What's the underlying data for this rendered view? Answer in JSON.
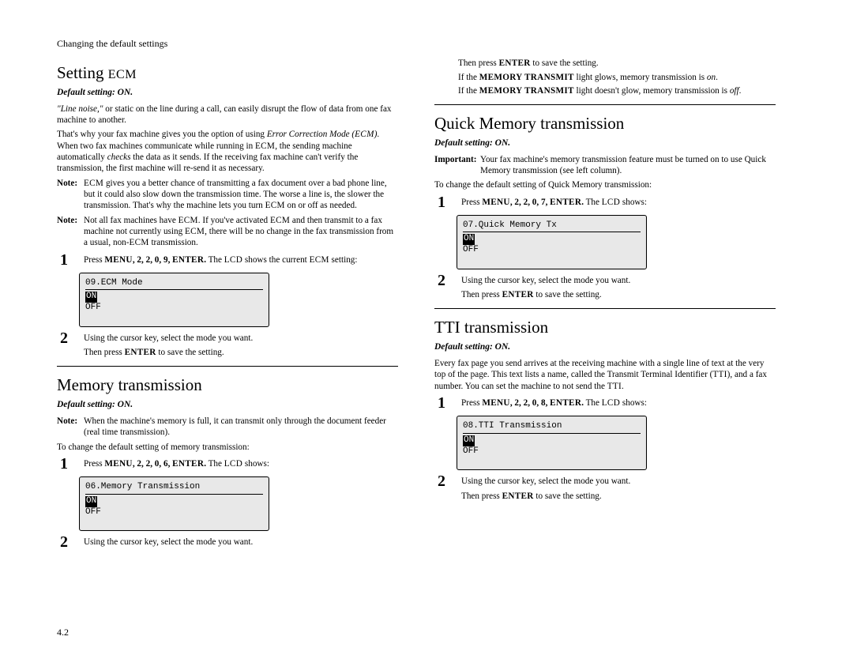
{
  "running_head": "Changing the default settings",
  "page_number": "4.2",
  "left": {
    "s1": {
      "title_a": "Setting ",
      "title_b": "ECM",
      "default": "Default setting: ON.",
      "p1a": "\"Line noise,\"",
      "p1b": " or static on the line during a call, can easily disrupt the flow of data from one fax machine to another.",
      "p2a": "That's why your fax machine gives you the option of using ",
      "p2b": "Error Correction Mode (",
      "p2c": "ECM",
      "p2d": ")",
      "p2e": ". When two fax machines communicate while running in ",
      "p2f": "ECM",
      "p2g": ", the sending machine automatically ",
      "p2h": "checks",
      "p2i": " the data as it sends. If the receiving fax machine can't verify the transmission, the first machine will re-send it as necessary.",
      "n1_label": "Note:",
      "n1a": "ECM",
      "n1b": " gives you a better chance of transmitting a fax document over a bad phone line, but it could also slow down the transmission time. The worse a line is, the slower the transmission. That's why the machine lets you turn ",
      "n1c": "ECM",
      "n1d": " on or off as needed.",
      "n2_label": "Note:",
      "n2a": "Not all fax machines have ",
      "n2b": "ECM",
      "n2c": ". If you've activated ",
      "n2d": "ECM",
      "n2e": " and then transmit to a fax machine not currently using ",
      "n2f": "ECM",
      "n2g": ", there will be no change in the fax transmission from a usual, non-",
      "n2h": "ECM",
      "n2i": " transmission.",
      "st1_num": "1",
      "st1a": "Press ",
      "st1b": "MENU",
      "st1c": ", 2, 2, 0, 9, ",
      "st1d": "ENTER",
      "st1e": ".",
      "st1f": " The ",
      "st1g": "LCD",
      "st1h": " shows the current ",
      "st1i": "ECM",
      "st1j": " setting:",
      "lcd1_l1": "09.ECM Mode",
      "lcd1_sel": "ON",
      "lcd1_l3": "OFF",
      "st2_num": "2",
      "st2a": "Using the cursor key, select the mode you want.",
      "st2b": "Then press ",
      "st2c": "ENTER",
      "st2d": " to save the setting."
    },
    "s2": {
      "title": "Memory transmission",
      "default": "Default setting: ON.",
      "n_label": "Note:",
      "n_body": "When the machine's memory is full, it can transmit only through the document feeder (real time transmission).",
      "intro": "To change the default setting of memory transmission:",
      "st1_num": "1",
      "st1a": "Press ",
      "st1b": "MENU",
      "st1c": ", 2, 2, 0, 6, ",
      "st1d": "ENTER",
      "st1e": ".",
      "st1f": " The ",
      "st1g": "LCD",
      "st1h": " shows:",
      "lcd_l1": "06.Memory Transmission",
      "lcd_sel": "ON",
      "lcd_l3": "OFF",
      "st2_num": "2",
      "st2a": "Using the cursor key, select the mode you want."
    }
  },
  "right": {
    "cont": {
      "l1a": "Then press ",
      "l1b": "ENTER",
      "l1c": " to save the setting.",
      "l2a": "If the ",
      "l2b": "MEMORY TRANSMIT",
      "l2c": " light glows, memory transmission is ",
      "l2d": "on",
      "l2e": ".",
      "l3a": "If the ",
      "l3b": "MEMORY TRANSMIT",
      "l3c": " light doesn't glow, memory transmission is ",
      "l3d": "off",
      "l3e": "."
    },
    "s3": {
      "title": "Quick Memory transmission",
      "default": "Default setting: ON.",
      "imp_label": "Important:",
      "imp_body": "Your fax machine's memory transmission feature must be turned on to use Quick Memory transmission (see left column).",
      "intro": "To change the default setting of Quick Memory transmission:",
      "st1_num": "1",
      "st1a": "Press ",
      "st1b": "MENU",
      "st1c": ", 2, 2, 0, 7, ",
      "st1d": "ENTER",
      "st1e": ".",
      "st1f": " The ",
      "st1g": "LCD",
      "st1h": " shows:",
      "lcd_l1": "07.Quick Memory Tx",
      "lcd_sel": "ON",
      "lcd_l3": "OFF",
      "st2_num": "2",
      "st2a": "Using the cursor key, select the mode you want.",
      "st2b": "Then press ",
      "st2c": "ENTER",
      "st2d": " to save the setting."
    },
    "s4": {
      "title": "TTI transmission",
      "default": "Default setting: ON.",
      "p1a": "Every fax page you send arrives at the receiving machine with a single line of text at the very top of the page. This text lists a name, called the Transmit Terminal Identifier (",
      "p1b": "TTI",
      "p1c": "), and a fax number. You can set the machine to not send the ",
      "p1d": "TTI",
      "p1e": ".",
      "st1_num": "1",
      "st1a": "Press ",
      "st1b": "MENU",
      "st1c": ", 2, 2, 0, 8, ",
      "st1d": "ENTER",
      "st1e": ".",
      "st1f": " The ",
      "st1g": "LCD",
      "st1h": " shows:",
      "lcd_l1": "08.TTI Transmission",
      "lcd_sel": "ON",
      "lcd_l3": "OFF",
      "st2_num": "2",
      "st2a": "Using the cursor key, select the mode you want.",
      "st2b": "Then press ",
      "st2c": "ENTER",
      "st2d": " to save the setting."
    }
  }
}
